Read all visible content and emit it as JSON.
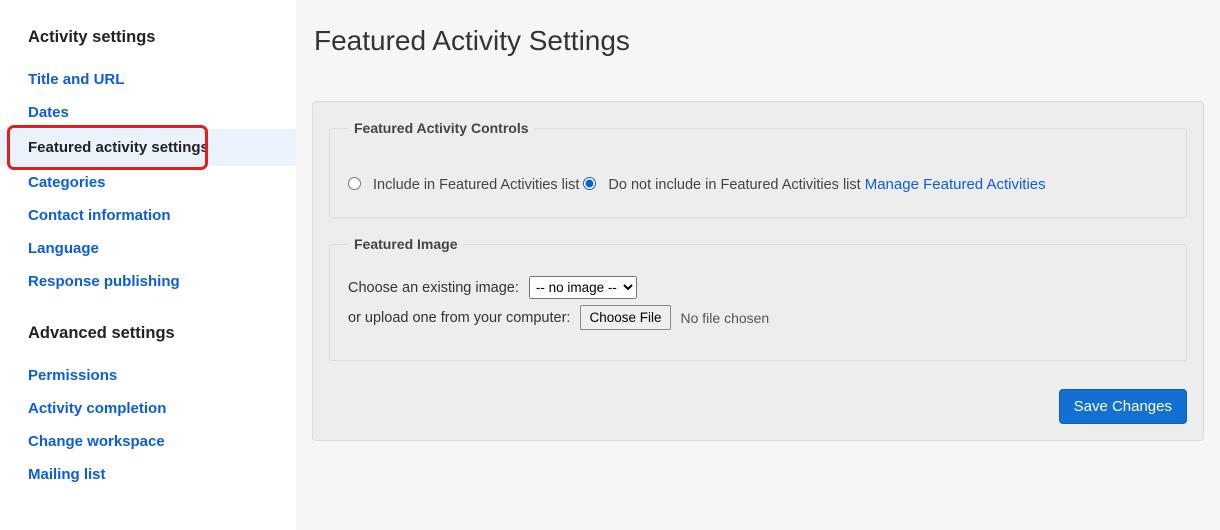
{
  "sidebar": {
    "section1_title": "Activity settings",
    "section2_title": "Advanced settings",
    "items1": [
      {
        "label": "Title and URL",
        "active": false
      },
      {
        "label": "Dates",
        "active": false
      },
      {
        "label": "Featured activity settings",
        "active": true
      },
      {
        "label": "Categories",
        "active": false
      },
      {
        "label": "Contact information",
        "active": false
      },
      {
        "label": "Language",
        "active": false
      },
      {
        "label": "Response publishing",
        "active": false
      }
    ],
    "items2": [
      {
        "label": "Permissions"
      },
      {
        "label": "Activity completion"
      },
      {
        "label": "Change workspace"
      },
      {
        "label": "Mailing list"
      }
    ]
  },
  "main": {
    "title": "Featured Activity Settings",
    "controls_legend": "Featured Activity Controls",
    "radio_include": "Include in Featured Activities list",
    "radio_exclude": "Do not include in Featured Activities list",
    "manage_link": "Manage Featured Activities",
    "image_legend": "Featured Image",
    "choose_existing": "Choose an existing image:",
    "select_options": [
      "-- no image --"
    ],
    "select_value": "-- no image --",
    "upload_prompt": "or upload one from your computer:",
    "choose_file_btn": "Choose File",
    "no_file": "No file chosen",
    "save_btn": "Save Changes"
  }
}
